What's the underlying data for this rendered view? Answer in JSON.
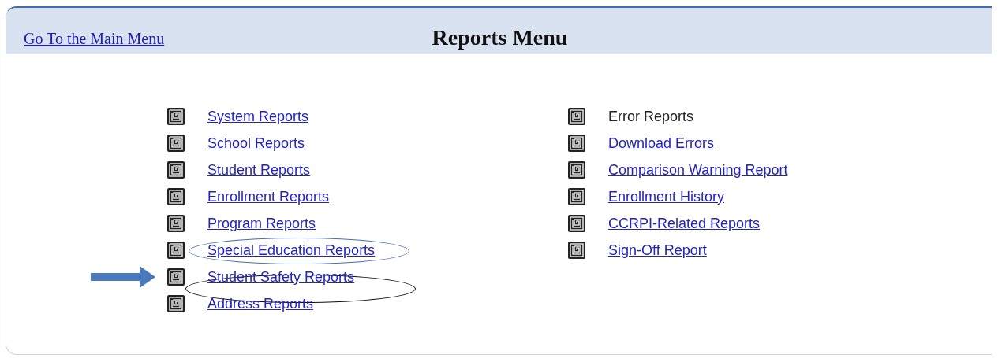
{
  "header": {
    "back_link": "Go To the Main Menu",
    "title": "Reports Menu"
  },
  "columns": [
    {
      "items": [
        {
          "label": "System Reports",
          "kind": "link"
        },
        {
          "label": "School Reports",
          "kind": "link"
        },
        {
          "label": "Student Reports",
          "kind": "link"
        },
        {
          "label": "Enrollment Reports",
          "kind": "link"
        },
        {
          "label": "Program Reports",
          "kind": "link"
        },
        {
          "label": "Special Education Reports",
          "kind": "link",
          "circled": true,
          "color": "#4a72b0"
        },
        {
          "label": "Student Safety Reports",
          "kind": "link",
          "circled": true,
          "color": "#111111",
          "arrow": true
        },
        {
          "label": "Address Reports",
          "kind": "link"
        }
      ]
    },
    {
      "items": [
        {
          "label": "Error Reports",
          "kind": "text"
        },
        {
          "label": "Download Errors",
          "kind": "link"
        },
        {
          "label": "Comparison Warning Report",
          "kind": "link"
        },
        {
          "label": "Enrollment History",
          "kind": "link"
        },
        {
          "label": "CCRPI-Related Reports",
          "kind": "link"
        },
        {
          "label": "Sign-Off Report",
          "kind": "link"
        }
      ]
    }
  ]
}
